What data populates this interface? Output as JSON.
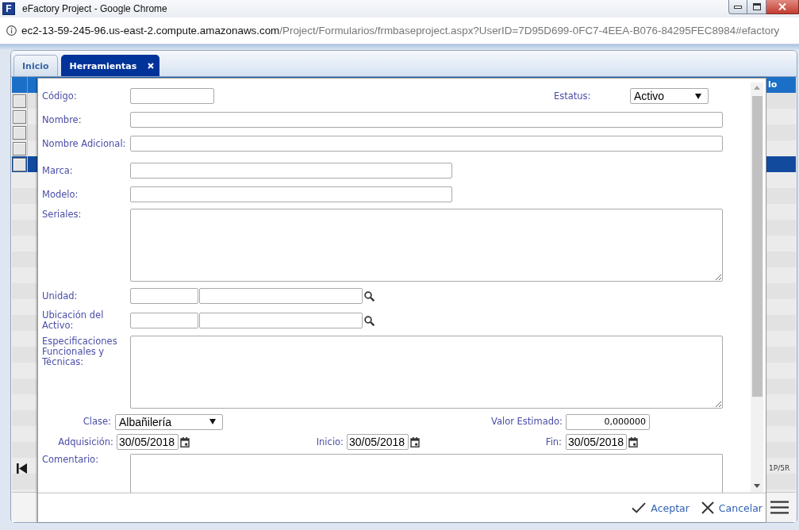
{
  "window": {
    "logo": "F",
    "title": "eFactory Project - Google Chrome"
  },
  "address_bar": {
    "host": "ec2-13-59-245-96.us-east-2.compute.amazonaws.com",
    "path": "/Project/Formularios/frmbaseproject.aspx?UserID=7D95D699-0FC7-4EEA-B076-84295FEC8984#efactory"
  },
  "tabs": [
    {
      "label": "Inicio",
      "selected": false,
      "closable": false
    },
    {
      "label": "Herramientas",
      "selected": true,
      "closable": true
    }
  ],
  "grid": {
    "column_header": "lo",
    "rows": [
      {
        "selected": false,
        "checked": false
      },
      {
        "selected": false,
        "checked": false
      },
      {
        "selected": false,
        "checked": false
      },
      {
        "selected": false,
        "checked": false
      },
      {
        "selected": true,
        "checked": false
      }
    ],
    "pager": "1P/5R"
  },
  "dialog": {
    "rows": [
      {
        "fields": [
          {
            "kind": "text",
            "label": "Código:"
          },
          {
            "kind": "select",
            "label": "Estatus:",
            "value": "Activo"
          }
        ]
      },
      {
        "fields": [
          {
            "kind": "text",
            "label": "Nombre:"
          }
        ]
      },
      {
        "fields": [
          {
            "kind": "text",
            "label": "Nombre Adicional:"
          }
        ]
      },
      {
        "fields": [
          {
            "kind": "text",
            "label": "Marca:"
          }
        ]
      },
      {
        "fields": [
          {
            "kind": "text",
            "label": "Modelo:"
          }
        ]
      },
      {
        "fields": [
          {
            "kind": "textarea",
            "label": "Seriales:"
          }
        ]
      },
      {
        "fields": [
          {
            "kind": "lookup",
            "label": "Unidad:"
          }
        ]
      },
      {
        "fields": [
          {
            "kind": "lookup",
            "label": "Ubicación del Activo:"
          }
        ]
      },
      {
        "fields": [
          {
            "kind": "textarea",
            "label": "Especificaciones Funcionales y Técnicas:"
          }
        ]
      },
      {
        "fields": [
          {
            "kind": "select",
            "label": "Clase:",
            "value": "Albañilería"
          },
          {
            "kind": "number",
            "label": "Valor Estimado:",
            "value": "0,000000"
          }
        ]
      },
      {
        "fields": [
          {
            "kind": "date",
            "label": "Adquisición:",
            "value": "30/05/2018"
          },
          {
            "kind": "date",
            "label": "Inicio:",
            "value": "30/05/2018"
          },
          {
            "kind": "date",
            "label": "Fin:",
            "value": "30/05/2018"
          }
        ]
      },
      {
        "fields": [
          {
            "kind": "textarea",
            "label": "Comentario:"
          }
        ]
      }
    ],
    "buttons": [
      {
        "label": "Aceptar",
        "kind": "accept"
      },
      {
        "label": "Cancelar",
        "kind": "cancel"
      }
    ]
  }
}
